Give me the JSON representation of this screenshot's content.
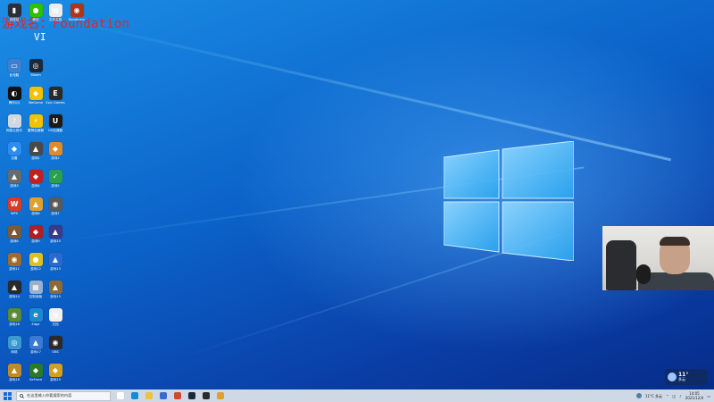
{
  "overlay": {
    "title": "游戏名：Foundation",
    "subtitle": "VI"
  },
  "desktop": {
    "icons": [
      {
        "label": "回收站",
        "color": "#2c2f3a",
        "glyph": "▮"
      },
      {
        "label": "微信",
        "color": "#2dc100",
        "glyph": "●"
      },
      {
        "label": "文本文档",
        "color": "#e8edf2",
        "glyph": "▤"
      },
      {
        "label": "Bandicam",
        "color": "#b0331c",
        "glyph": "◉"
      },
      {
        "label": "此电脑",
        "color": "#3f7fd0",
        "glyph": "▭"
      },
      {
        "label": "Steam",
        "color": "#1b2838",
        "glyph": "◎"
      },
      {
        "label": "腾讯QQ",
        "color": "#111111",
        "glyph": "◐"
      },
      {
        "label": "WeGame",
        "color": "#f4c000",
        "glyph": "◆"
      },
      {
        "label": "Epic Games",
        "color": "#2a2a2a",
        "glyph": "E"
      },
      {
        "label": "网易云音乐",
        "color": "#d0d8e0",
        "glyph": "♪"
      },
      {
        "label": "雷神加速器",
        "color": "#f2c200",
        "glyph": "⚡"
      },
      {
        "label": "UU加速器",
        "color": "#1a1a1a",
        "glyph": "U"
      },
      {
        "label": "迅雷",
        "color": "#2d8cf0",
        "glyph": "◆"
      },
      {
        "label": "游戏1",
        "color": "#4a4a4a",
        "glyph": "▲"
      },
      {
        "label": "游戏2",
        "color": "#e08a2a",
        "glyph": "◆"
      },
      {
        "label": "游戏3",
        "color": "#6a6a6a",
        "glyph": "▲"
      },
      {
        "label": "游戏4",
        "color": "#c02020",
        "glyph": "◆"
      },
      {
        "label": "游戏5",
        "color": "#2aa04a",
        "glyph": "✓"
      },
      {
        "label": "WPS",
        "color": "#d93a2a",
        "glyph": "W"
      },
      {
        "label": "游戏6",
        "color": "#e0a030",
        "glyph": "▲"
      },
      {
        "label": "游戏7",
        "color": "#5a5a5a",
        "glyph": "◉"
      },
      {
        "label": "游戏8",
        "color": "#7a5a3a",
        "glyph": "▲"
      },
      {
        "label": "游戏9",
        "color": "#b02020",
        "glyph": "◆"
      },
      {
        "label": "游戏10",
        "color": "#3a3a8a",
        "glyph": "▲"
      },
      {
        "label": "游戏11",
        "color": "#a06a2a",
        "glyph": "◉"
      },
      {
        "label": "游戏12",
        "color": "#e0c020",
        "glyph": "●"
      },
      {
        "label": "游戏13",
        "color": "#2a6ad0",
        "glyph": "▲"
      },
      {
        "label": "游戏14",
        "color": "#2a2a2a",
        "glyph": "▲"
      },
      {
        "label": "控制面板",
        "color": "#9ab0c8",
        "glyph": "▦"
      },
      {
        "label": "游戏15",
        "color": "#8a6a3a",
        "glyph": "▲"
      },
      {
        "label": "游戏16",
        "color": "#5a8a3a",
        "glyph": "◉"
      },
      {
        "label": "Edge",
        "color": "#1a8ad0",
        "glyph": "e"
      },
      {
        "label": "文档",
        "color": "#f0f0f0",
        "glyph": "▤"
      },
      {
        "label": "网络",
        "color": "#3a9ad0",
        "glyph": "◎"
      },
      {
        "label": "游戏17",
        "color": "#3a7ad0",
        "glyph": "▲"
      },
      {
        "label": "OBS",
        "color": "#2a2a2a",
        "glyph": "◉"
      },
      {
        "label": "游戏18",
        "color": "#c08a2a",
        "glyph": "▲"
      },
      {
        "label": "GeForce",
        "color": "#2a7a2a",
        "glyph": "◆"
      },
      {
        "label": "游戏19",
        "color": "#d0a020",
        "glyph": "◆"
      },
      {
        "label": "游戏20",
        "color": "#a08a5a",
        "glyph": "▲"
      },
      {
        "label": "Steam",
        "color": "#1b2838",
        "glyph": "◎"
      },
      {
        "label": "游戏21",
        "color": "#2a2a2a",
        "glyph": "◉"
      },
      {
        "label": "游戏22",
        "color": "#f0c040",
        "glyph": "◆"
      }
    ]
  },
  "weather": {
    "temp": "11°",
    "desc": "多云"
  },
  "taskbar": {
    "search_placeholder": "在这里输入你要搜索的内容",
    "apps": [
      {
        "name": "task-view",
        "color": "#ffffff"
      },
      {
        "name": "edge",
        "color": "#1a8ad0"
      },
      {
        "name": "file-explorer",
        "color": "#f0c040"
      },
      {
        "name": "store",
        "color": "#3a6ad0"
      },
      {
        "name": "chrome",
        "color": "#d04a2a"
      },
      {
        "name": "steam",
        "color": "#1b2838"
      },
      {
        "name": "obs",
        "color": "#2a2a2a"
      },
      {
        "name": "game",
        "color": "#e0a030"
      }
    ],
    "tray": {
      "weather_short": "11°C 多云",
      "time": "14:05",
      "date": "2021/12/4"
    }
  }
}
